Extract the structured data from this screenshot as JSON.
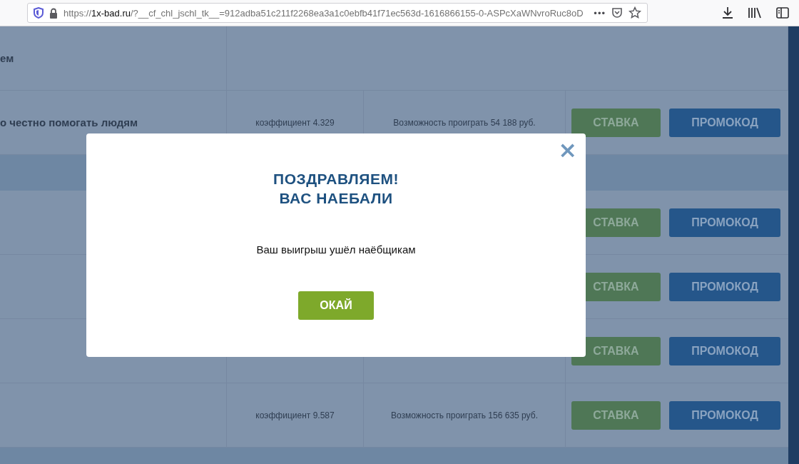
{
  "browser": {
    "url_scheme": "https://",
    "url_host": "1x-bad.ru",
    "url_path": "/?__cf_chl_jschl_tk__=912adba51c211f2268ea3a1c0ebfb41f71ec563d-1616866155-0-ASPcXaWNvroRuc8oD",
    "more": "•••"
  },
  "rows": [
    {
      "kind": "header",
      "title": "ем"
    },
    {
      "kind": "bet",
      "title": "о честно помогать людям",
      "coefficient": "коэффициент 4.329",
      "chance": "Возможность проиграть 54 188 руб.",
      "bet_button": "СТАВКА",
      "promo_button": "ПРОМОКОД"
    },
    {
      "kind": "band"
    },
    {
      "kind": "bet",
      "bet_button": "СТАВКА",
      "promo_button": "ПРОМОКОД"
    },
    {
      "kind": "bet",
      "bet_button": "СТАВКА",
      "promo_button": "ПРОМОКОД"
    },
    {
      "kind": "bet",
      "bet_button": "СТАВКА",
      "promo_button": "ПРОМОКОД"
    },
    {
      "kind": "bet",
      "coefficient": "коэффициент 9.587",
      "chance": "Возможность проиграть 156 635 руб.",
      "bet_button": "СТАВКА",
      "promo_button": "ПРОМОКОД"
    },
    {
      "kind": "band"
    }
  ],
  "modal": {
    "close": "×",
    "title_lines": [
      "ПОЗДРАВЛЯЕМ!",
      "ВАС НАЕБАЛИ"
    ],
    "message": "Ваш выигрыш ушёл наёбщикам",
    "ok_button": "ОКАЙ"
  }
}
